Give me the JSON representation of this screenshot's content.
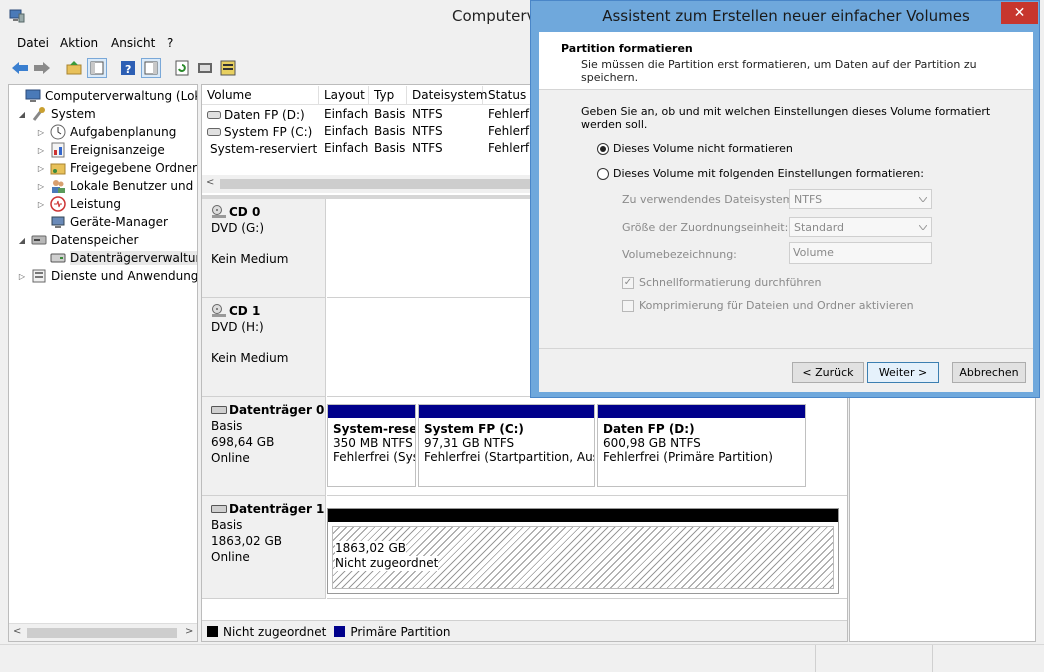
{
  "app": {
    "title": "Computerverwaltung"
  },
  "menu": [
    {
      "label": "Datei"
    },
    {
      "label": "Aktion"
    },
    {
      "label": "Ansicht"
    },
    {
      "label": "?"
    }
  ],
  "tree": [
    {
      "label": "Computerverwaltung (Lokal)",
      "icon": "computer-icon",
      "exp": ""
    },
    {
      "label": "System",
      "icon": "tools-icon",
      "exp": "◢"
    },
    {
      "label": "Aufgabenplanung",
      "icon": "clock-icon",
      "exp": "▷"
    },
    {
      "label": "Ereignisanzeige",
      "icon": "event-log-icon",
      "exp": "▷"
    },
    {
      "label": "Freigegebene Ordner",
      "icon": "shared-folder-icon",
      "exp": "▷"
    },
    {
      "label": "Lokale Benutzer und Gruppen",
      "icon": "users-icon",
      "exp": "▷"
    },
    {
      "label": "Leistung",
      "icon": "performance-icon",
      "exp": "▷"
    },
    {
      "label": "Geräte-Manager",
      "icon": "device-manager-icon",
      "exp": ""
    },
    {
      "label": "Datenspeicher",
      "icon": "storage-icon",
      "exp": "◢"
    },
    {
      "label": "Datenträgerverwaltung",
      "icon": "disk-management-icon",
      "exp": ""
    },
    {
      "label": "Dienste und Anwendungen",
      "icon": "services-icon",
      "exp": "▷"
    }
  ],
  "volumes": {
    "headers": [
      "Volume",
      "Layout",
      "Typ",
      "Dateisystem",
      "Status"
    ],
    "rows": [
      [
        "Daten FP (D:)",
        "Einfach",
        "Basis",
        "NTFS",
        "Fehlerfrei"
      ],
      [
        "System FP (C:)",
        "Einfach",
        "Basis",
        "NTFS",
        "Fehlerfrei"
      ],
      [
        "System-reserviert",
        "Einfach",
        "Basis",
        "NTFS",
        "Fehlerfrei"
      ]
    ]
  },
  "disks": {
    "cd0": {
      "name": "CD 0",
      "line1": "DVD (G:)",
      "line2": "Kein Medium"
    },
    "cd1": {
      "name": "CD 1",
      "line1": "DVD (H:)",
      "line2": "Kein Medium"
    },
    "disk0": {
      "name": "Datenträger 0",
      "line1": "Basis",
      "line2": "698,64 GB",
      "line3": "Online",
      "partitions": [
        {
          "name": "System-reserviert",
          "size": "350 MB NTFS",
          "status": "Fehlerfrei (System, Aktiv, Primäre Partition)"
        },
        {
          "name": "System FP  (C:)",
          "size": "97,31 GB NTFS",
          "status": "Fehlerfrei (Startpartition, Auslagerungsdatei, Absturzabbild, Primäre Partition)"
        },
        {
          "name": "Daten FP  (D:)",
          "size": "600,98 GB NTFS",
          "status": "Fehlerfrei (Primäre Partition)"
        }
      ]
    },
    "disk1": {
      "name": "Datenträger 1",
      "line1": "Basis",
      "line2": "1863,02 GB",
      "line3": "Online",
      "unalloc_size": "1863,02 GB",
      "unalloc_label": "Nicht zugeordnet"
    }
  },
  "legend": {
    "unallocated": "Nicht zugeordnet",
    "primary": "Primäre Partition"
  },
  "wizard": {
    "title": "Assistent zum Erstellen neuer einfacher Volumes",
    "close": "✕",
    "header_title": "Partition formatieren",
    "header_sub": "Sie müssen die Partition erst formatieren, um Daten auf der Partition zu speichern.",
    "prompt": "Geben Sie an, ob und mit welchen Einstellungen dieses Volume formatiert werden soll.",
    "radio_no_format": "Dieses Volume nicht formatieren",
    "radio_format": "Dieses Volume mit folgenden Einstellungen formatieren:",
    "fs_label": "Zu verwendendes Dateisystem:",
    "fs_value": "NTFS",
    "alloc_label": "Größe der Zuordnungseinheit:",
    "alloc_value": "Standard",
    "vol_label": "Volumebezeichnung:",
    "vol_value": "Volume",
    "quick_format": "Schnellformatierung durchführen",
    "compression": "Komprimierung für Dateien und Ordner aktivieren",
    "btn_back": "< Zurück",
    "btn_next": "Weiter >",
    "btn_cancel": "Abbrechen"
  },
  "colors": {
    "primary_partition": "#00008b",
    "unallocated": "#000000",
    "wizard_frame": "#6fa8dc",
    "close_button": "#c7362e"
  }
}
